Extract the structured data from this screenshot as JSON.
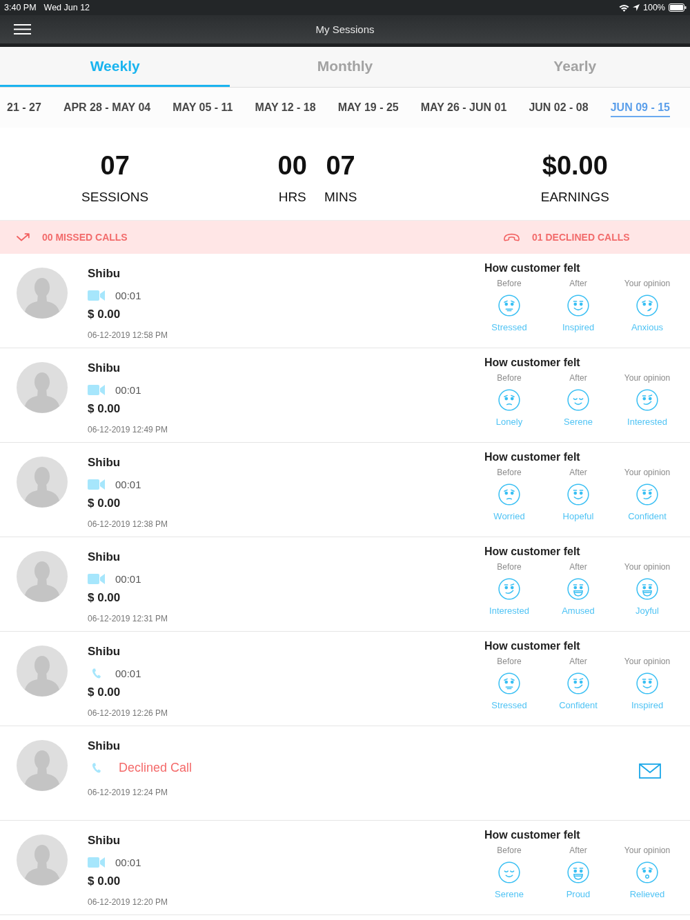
{
  "status_bar": {
    "time": "3:40 PM",
    "date": "Wed Jun 12",
    "battery": "100%"
  },
  "nav": {
    "title": "My Sessions"
  },
  "tabs": [
    {
      "label": "Weekly",
      "selected": true
    },
    {
      "label": "Monthly",
      "selected": false
    },
    {
      "label": "Yearly",
      "selected": false
    }
  ],
  "weeks": [
    {
      "label": "21 - 27",
      "selected": false
    },
    {
      "label": "APR 28 - MAY 04",
      "selected": false
    },
    {
      "label": "MAY 05 - 11",
      "selected": false
    },
    {
      "label": "MAY 12 - 18",
      "selected": false
    },
    {
      "label": "MAY 19 - 25",
      "selected": false
    },
    {
      "label": "MAY 26 - JUN 01",
      "selected": false
    },
    {
      "label": "JUN 02 - 08",
      "selected": false
    },
    {
      "label": "JUN 09 - 15",
      "selected": true
    }
  ],
  "stats": {
    "sessions": {
      "value": "07",
      "label": "SESSIONS"
    },
    "hours": {
      "value": "00",
      "label": "HRS"
    },
    "minutes": {
      "value": "07",
      "label": "MINS"
    },
    "earnings": {
      "value": "$0.00",
      "label": "EARNINGS"
    }
  },
  "calls_summary": {
    "missed": "00 MISSED CALLS",
    "declined": "01 DECLINED CALLS"
  },
  "sessions": [
    {
      "kind": "completed",
      "name": "Shibu",
      "call": {
        "kind": "video",
        "duration": "00:01"
      },
      "amount": "$ 0.00",
      "date": "06-12-2019 12:58 PM",
      "feedback": {
        "title": "How customer felt",
        "moods": [
          {
            "label": "Before",
            "mood": "Stressed",
            "kind": "tense"
          },
          {
            "label": "After",
            "mood": "Inspired",
            "kind": "smile"
          },
          {
            "label": "Your opinion",
            "mood": "Anxious",
            "kind": "uneasy"
          }
        ]
      }
    },
    {
      "kind": "completed",
      "name": "Shibu",
      "call": {
        "kind": "video",
        "duration": "00:01"
      },
      "amount": "$ 0.00",
      "date": "06-12-2019 12:49 PM",
      "feedback": {
        "title": "How customer felt",
        "moods": [
          {
            "label": "Before",
            "mood": "Lonely",
            "kind": "sad"
          },
          {
            "label": "After",
            "mood": "Serene",
            "kind": "calm"
          },
          {
            "label": "Your opinion",
            "mood": "Interested",
            "kind": "smirk"
          }
        ]
      }
    },
    {
      "kind": "completed",
      "name": "Shibu",
      "call": {
        "kind": "video",
        "duration": "00:01"
      },
      "amount": "$ 0.00",
      "date": "06-12-2019 12:38 PM",
      "feedback": {
        "title": "How customer felt",
        "moods": [
          {
            "label": "Before",
            "mood": "Worried",
            "kind": "sad"
          },
          {
            "label": "After",
            "mood": "Hopeful",
            "kind": "smile"
          },
          {
            "label": "Your opinion",
            "mood": "Confident",
            "kind": "smirk"
          }
        ]
      }
    },
    {
      "kind": "completed",
      "name": "Shibu",
      "call": {
        "kind": "video",
        "duration": "00:01"
      },
      "amount": "$ 0.00",
      "date": "06-12-2019 12:31 PM",
      "feedback": {
        "title": "How customer felt",
        "moods": [
          {
            "label": "Before",
            "mood": "Interested",
            "kind": "smirk"
          },
          {
            "label": "After",
            "mood": "Amused",
            "kind": "grin"
          },
          {
            "label": "Your opinion",
            "mood": "Joyful",
            "kind": "grin"
          }
        ]
      }
    },
    {
      "kind": "completed",
      "name": "Shibu",
      "call": {
        "kind": "phone",
        "duration": "00:01"
      },
      "amount": "$ 0.00",
      "date": "06-12-2019 12:26 PM",
      "feedback": {
        "title": "How customer felt",
        "moods": [
          {
            "label": "Before",
            "mood": "Stressed",
            "kind": "tense"
          },
          {
            "label": "After",
            "mood": "Confident",
            "kind": "smirk"
          },
          {
            "label": "Your opinion",
            "mood": "Inspired",
            "kind": "smile"
          }
        ]
      }
    },
    {
      "kind": "declined",
      "name": "Shibu",
      "call": {
        "kind": "phone",
        "status": "Declined Call"
      },
      "date": "06-12-2019 12:24 PM"
    },
    {
      "kind": "completed",
      "name": "Shibu",
      "call": {
        "kind": "video",
        "duration": "00:01"
      },
      "amount": "$ 0.00",
      "date": "06-12-2019 12:20 PM",
      "feedback": {
        "title": "How customer felt",
        "moods": [
          {
            "label": "Before",
            "mood": "Serene",
            "kind": "calm"
          },
          {
            "label": "After",
            "mood": "Proud",
            "kind": "grin"
          },
          {
            "label": "Your opinion",
            "mood": "Relieved",
            "kind": "open"
          }
        ]
      }
    }
  ]
}
